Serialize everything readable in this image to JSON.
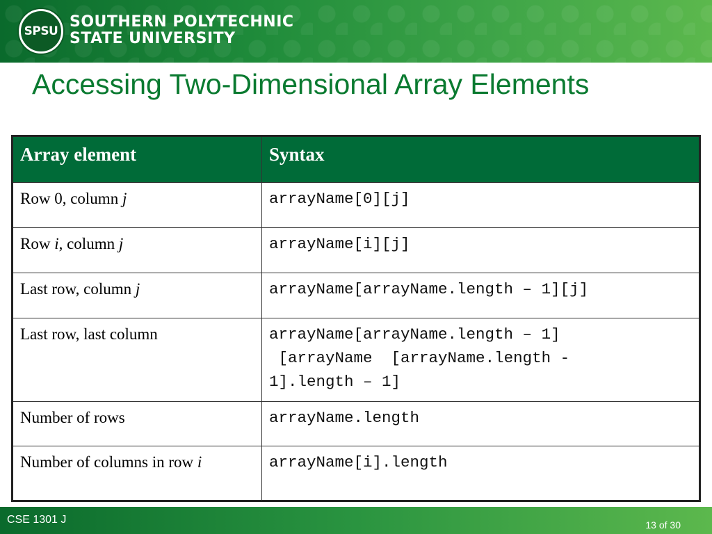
{
  "header": {
    "logo_text": "SPSU",
    "university_line1": "SOUTHERN POLYTECHNIC",
    "university_line2": "STATE UNIVERSITY"
  },
  "title": "Accessing Two-Dimensional Array Elements",
  "table": {
    "headers": [
      "Array element",
      "Syntax"
    ],
    "rows": [
      {
        "pre": "Row 0, column ",
        "var1": "",
        "mid": "",
        "var2": "j",
        "syntax": "arrayName[0][j]"
      },
      {
        "pre": "Row ",
        "var1": "i",
        "mid": ", column ",
        "var2": "j",
        "syntax": "arrayName[i][j]"
      },
      {
        "pre": "Last row, column ",
        "var1": "",
        "mid": "",
        "var2": "j",
        "syntax": "arrayName[arrayName.length – 1][j]"
      },
      {
        "pre": "Last row, last column",
        "var1": "",
        "mid": "",
        "var2": "",
        "syntax": "arrayName[arrayName.length – 1]\n [arrayName  [arrayName.length -\n1].length – 1]"
      },
      {
        "pre": "Number of rows",
        "var1": "",
        "mid": "",
        "var2": "",
        "syntax": "arrayName.length"
      },
      {
        "pre": "Number of columns in row ",
        "var1": "",
        "mid": "",
        "var2": "i",
        "syntax": "arrayName[i].length"
      }
    ]
  },
  "footer": {
    "course": "CSE 1301 J",
    "page": "13 of 30"
  },
  "colors": {
    "brand_green": "#006b38",
    "title_green": "#0a7a30"
  }
}
